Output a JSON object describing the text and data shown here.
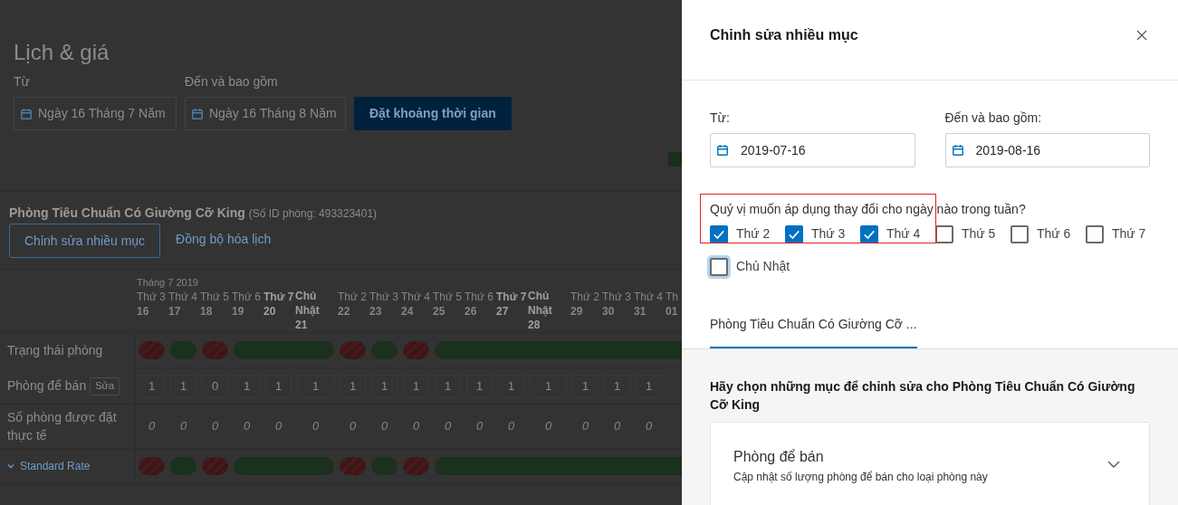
{
  "page": {
    "title": "Lịch & giá",
    "from_label": "Từ",
    "from_value": "Ngày 16 Tháng 7 Năm",
    "to_label": "Đến và bao gồm",
    "to_value": "Ngày 16 Tháng 8 Năm",
    "set_button": "Đặt khoảng thời gian"
  },
  "room": {
    "name": "Phòng Tiêu Chuẩn Có Giường Cỡ King",
    "id_note": "(Số ID phòng: 493323401)",
    "edit_button": "Chỉnh sửa nhiều mục",
    "sync_link": "Đồng bộ hóa lịch"
  },
  "calendar": {
    "row_labels": {
      "status": "Trạng thái phòng",
      "rooms": "Phòng để bán",
      "rooms_edit": "Sửa",
      "booked": "Số phòng được đặt thực tế",
      "rate": "Standard Rate"
    },
    "days": [
      {
        "month": "Tháng 7 2019",
        "weekday": "Thứ 3",
        "date": "16",
        "weekend": false,
        "closed": true,
        "rooms": "1",
        "booked": "0",
        "rate_closed": true
      },
      {
        "weekday": "Thứ 4",
        "date": "17",
        "weekend": false,
        "closed": false,
        "rooms": "1",
        "booked": "0",
        "rate_closed": false
      },
      {
        "weekday": "Thứ 5",
        "date": "18",
        "weekend": false,
        "closed": true,
        "rooms": "0",
        "booked": "0",
        "rate_closed": true
      },
      {
        "weekday": "Thứ 6",
        "date": "19",
        "weekend": false,
        "closed": false,
        "rooms": "1",
        "booked": "0",
        "rate_closed": false
      },
      {
        "weekday": "Thứ 7",
        "date": "20",
        "weekend": true,
        "closed": false,
        "rooms": "1",
        "booked": "0",
        "rate_closed": false
      },
      {
        "weekday": "Chủ Nhật",
        "date": "21",
        "weekend": true,
        "closed": false,
        "rooms": "1",
        "booked": "0",
        "rate_closed": false
      },
      {
        "weekday": "Thứ 2",
        "date": "22",
        "weekend": false,
        "closed": true,
        "rooms": "1",
        "booked": "0",
        "rate_closed": true
      },
      {
        "weekday": "Thứ 3",
        "date": "23",
        "weekend": false,
        "closed": false,
        "rooms": "1",
        "booked": "0",
        "rate_closed": false
      },
      {
        "weekday": "Thứ 4",
        "date": "24",
        "weekend": false,
        "closed": true,
        "rooms": "1",
        "booked": "0",
        "rate_closed": true
      },
      {
        "weekday": "Thứ 5",
        "date": "25",
        "weekend": false,
        "closed": false,
        "rooms": "1",
        "booked": "0",
        "rate_closed": false
      },
      {
        "weekday": "Thứ 6",
        "date": "26",
        "weekend": false,
        "closed": false,
        "rooms": "1",
        "booked": "0",
        "rate_closed": false
      },
      {
        "weekday": "Thứ 7",
        "date": "27",
        "weekend": true,
        "closed": false,
        "rooms": "1",
        "booked": "0",
        "rate_closed": false
      },
      {
        "weekday": "Chủ Nhật",
        "date": "28",
        "weekend": true,
        "closed": false,
        "rooms": "1",
        "booked": "0",
        "rate_closed": false
      },
      {
        "weekday": "Thứ 2",
        "date": "29",
        "weekend": false,
        "closed": false,
        "rooms": "1",
        "booked": "0",
        "rate_closed": false
      },
      {
        "weekday": "Thứ 3",
        "date": "30",
        "weekend": false,
        "closed": false,
        "rooms": "1",
        "booked": "0",
        "rate_closed": false
      },
      {
        "weekday": "Thứ 4",
        "date": "31",
        "weekend": false,
        "closed": false,
        "rooms": "1",
        "booked": "0",
        "rate_closed": false
      },
      {
        "weekday": "Th",
        "date": "01",
        "weekend": false,
        "closed": false,
        "rate_closed": false
      }
    ]
  },
  "panel": {
    "title": "Chỉnh sửa nhiều mục",
    "from_label": "Từ:",
    "from_value": "2019-07-16",
    "to_label": "Đến và bao gồm:",
    "to_value": "2019-08-16",
    "question": "Quý vị muốn áp dụng thay đổi cho ngày nào trong tuần?",
    "days": [
      {
        "label": "Thứ 2",
        "checked": true,
        "focused": false
      },
      {
        "label": "Thứ 3",
        "checked": true,
        "focused": false
      },
      {
        "label": "Thứ 4",
        "checked": true,
        "focused": false
      },
      {
        "label": "Thứ 5",
        "checked": false,
        "focused": false
      },
      {
        "label": "Thứ 6",
        "checked": false,
        "focused": false
      },
      {
        "label": "Thứ 7",
        "checked": false,
        "focused": false
      },
      {
        "label": "Chủ Nhật",
        "checked": false,
        "focused": true
      }
    ],
    "tabs": [
      {
        "label": "Phòng Tiêu Chuẩn Có Giường Cỡ ...",
        "selected": true
      }
    ],
    "section_heading": "Hãy chọn những mục để chỉnh sửa cho Phòng Tiêu Chuẩn Có Giường Cỡ King",
    "items": [
      {
        "title": "Phòng để bán",
        "description": "Cập nhật số lượng phòng để bán cho loại phòng này",
        "expanded": false
      }
    ]
  }
}
